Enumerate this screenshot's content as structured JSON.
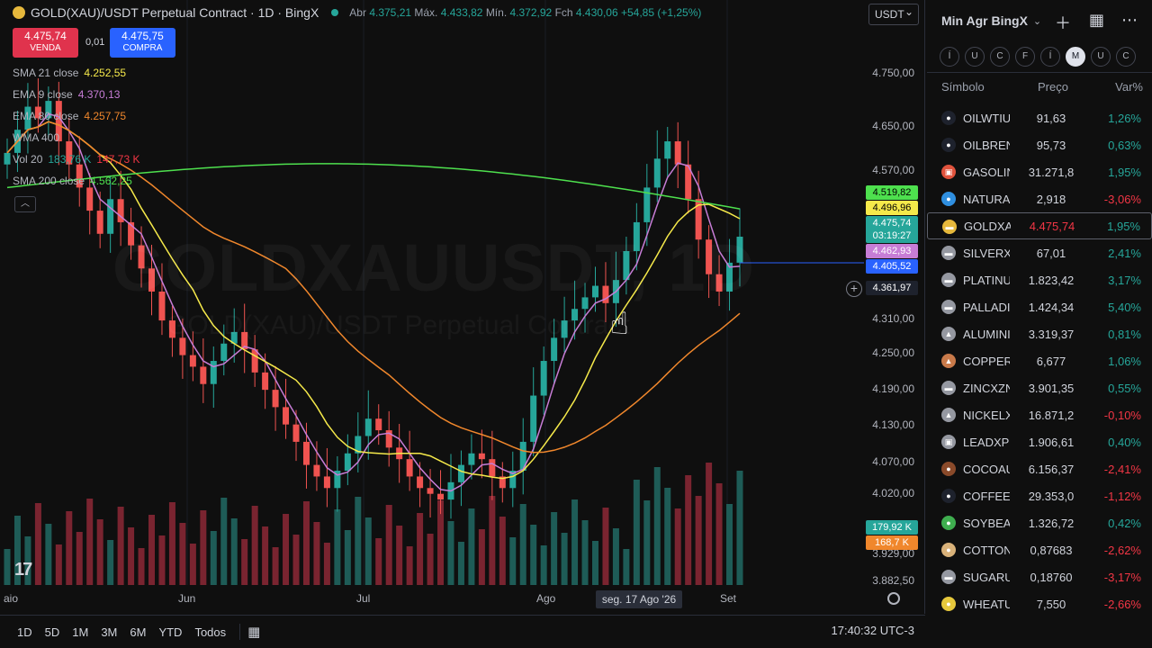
{
  "chart_header": {
    "title": "GOLD(XAU)/USDT Perpetual Contract · 1D · BingX",
    "open_label": "Abr",
    "open": "4.375,21",
    "high_label": "Máx.",
    "high": "4.433,82",
    "low_label": "Mín.",
    "low": "4.372,92",
    "close_label": "Fch",
    "close": "4.430,06",
    "change": "+54,85 (+1,25%)"
  },
  "trade": {
    "sell_price": "4.475,74",
    "sell_label": "VENDA",
    "spread": "0,01",
    "buy_price": "4.475,75",
    "buy_label": "COMPRA"
  },
  "indicators": [
    {
      "name": "SMA 21 close",
      "value": "4.252,55",
      "color": "#f5e94a"
    },
    {
      "name": "EMA 9 close",
      "value": "4.370,13",
      "color": "#c77dd6"
    },
    {
      "name": "EMA 80 close",
      "value": "4.257,75",
      "color": "#f0872c"
    },
    {
      "name": "WMA 400",
      "value": "",
      "color": "#787b86"
    },
    {
      "name": "Vol 20",
      "value": "183,76 K",
      "value2": "147,73 K",
      "color": "#26a69a"
    },
    {
      "name": "SMA 200 close",
      "value": "4.562,25",
      "color": "#4ee04e"
    }
  ],
  "watermark": {
    "line1": "GOLDXAUUSDT, 1D",
    "line2": "GOLD(XAU)/USDT Perpetual Contract"
  },
  "quote_currency": "USDT",
  "price_axis": [
    "4.750,00",
    "4.650,00",
    "4.570,00",
    "4.310,00",
    "4.250,00",
    "4.190,00",
    "4.130,00",
    "4.070,00",
    "4.020,00",
    "3.929,00",
    "3.882,50"
  ],
  "price_tags": [
    {
      "value": "4.519,82",
      "color": "#4ee04e"
    },
    {
      "value": "4.496,96",
      "color": "#f5e94a"
    },
    {
      "value": "4.475,74",
      "sub": "03:19:27",
      "color": "#26a69a"
    },
    {
      "value": "4.462,93",
      "color": "#c77dd6"
    },
    {
      "value": "4.405,52",
      "color": "#2962ff"
    },
    {
      "value": "4.361,97",
      "color": "#1e222d"
    },
    {
      "value": "179,92 K",
      "color": "#26a69a"
    },
    {
      "value": "168,7 K",
      "color": "#f0872c"
    }
  ],
  "time_axis": [
    "aio",
    "Jun",
    "Jul",
    "Ago",
    "Set"
  ],
  "crosshair_date": "seg. 17 Ago '26",
  "ranges": [
    "1D",
    "5D",
    "1M",
    "3M",
    "6M",
    "YTD",
    "Todos"
  ],
  "clock": "17:40:32 UTC-3",
  "watchlist": {
    "title": "Min Agr BingX",
    "filters": [
      "Í",
      "U",
      "C",
      "F",
      "Í",
      "M",
      "U",
      "C"
    ],
    "active_filter_index": 5,
    "col_symbol": "Símbolo",
    "col_price": "Preço",
    "col_change": "Var%",
    "rows": [
      {
        "sym": "OILWTIU",
        "price": "91,63",
        "chg": "1,26%",
        "dir": "up",
        "icon_color": "#1e222d",
        "icon": "●"
      },
      {
        "sym": "OILBREN",
        "price": "95,73",
        "chg": "0,63%",
        "dir": "up",
        "icon_color": "#1e222d",
        "icon": "●"
      },
      {
        "sym": "GASOLIN",
        "price": "31.271,8",
        "chg": "1,95%",
        "dir": "up",
        "icon_color": "#e0533d",
        "icon": "▣"
      },
      {
        "sym": "NATURA",
        "price": "2,918",
        "chg": "-3,06%",
        "dir": "down",
        "icon_color": "#2f8fe0",
        "icon": "●"
      },
      {
        "sym": "GOLDXA",
        "price": "4.475,74",
        "chg": "1,95%",
        "dir": "up",
        "icon_color": "#e6b83c",
        "icon": "▬",
        "selected": true
      },
      {
        "sym": "SILVERX",
        "price": "67,01",
        "chg": "2,41%",
        "dir": "up",
        "icon_color": "#9598a1",
        "icon": "▬"
      },
      {
        "sym": "PLATINU",
        "price": "1.823,42",
        "chg": "3,17%",
        "dir": "up",
        "icon_color": "#9598a1",
        "icon": "▬"
      },
      {
        "sym": "PALLADI",
        "price": "1.424,34",
        "chg": "5,40%",
        "dir": "up",
        "icon_color": "#9598a1",
        "icon": "▬"
      },
      {
        "sym": "ALUMINI",
        "price": "3.319,37",
        "chg": "0,81%",
        "dir": "up",
        "icon_color": "#9598a1",
        "icon": "▲"
      },
      {
        "sym": "COPPER",
        "price": "6,677",
        "chg": "1,06%",
        "dir": "up",
        "icon_color": "#c97a4a",
        "icon": "▲"
      },
      {
        "sym": "ZINCXZN",
        "price": "3.901,35",
        "chg": "0,55%",
        "dir": "up",
        "icon_color": "#9598a1",
        "icon": "▬"
      },
      {
        "sym": "NICKELX",
        "price": "16.871,2",
        "chg": "-0,10%",
        "dir": "down",
        "icon_color": "#9598a1",
        "icon": "▲"
      },
      {
        "sym": "LEADXPI",
        "price": "1.906,61",
        "chg": "0,40%",
        "dir": "up",
        "icon_color": "#9598a1",
        "icon": "▣"
      },
      {
        "sym": "COCOAU",
        "price": "6.156,37",
        "chg": "-2,41%",
        "dir": "down",
        "icon_color": "#8a4a2a",
        "icon": "●"
      },
      {
        "sym": "COFFEEU",
        "price": "29.353,0",
        "chg": "-1,12%",
        "dir": "down",
        "icon_color": "#1e222d",
        "icon": "●"
      },
      {
        "sym": "SOYBEAI",
        "price": "1.326,72",
        "chg": "0,42%",
        "dir": "up",
        "icon_color": "#3fae4f",
        "icon": "●"
      },
      {
        "sym": "COTTON",
        "price": "0,87683",
        "chg": "-2,62%",
        "dir": "down",
        "icon_color": "#d9b27a",
        "icon": "●"
      },
      {
        "sym": "SUGARU",
        "price": "0,18760",
        "chg": "-3,17%",
        "dir": "down",
        "icon_color": "#9598a1",
        "icon": "▬"
      },
      {
        "sym": "WHEATU",
        "price": "7,550",
        "chg": "-2,66%",
        "dir": "down",
        "icon_color": "#e6c83c",
        "icon": "●"
      }
    ]
  },
  "chart_data": {
    "type": "candlestick",
    "series_closes": [
      4620,
      4660,
      4700,
      4680,
      4710,
      4640,
      4600,
      4560,
      4520,
      4480,
      4540,
      4500,
      4460,
      4420,
      4380,
      4330,
      4300,
      4270,
      4250,
      4220,
      4260,
      4290,
      4310,
      4280,
      4240,
      4210,
      4180,
      4150,
      4120,
      4080,
      4060,
      4040,
      4070,
      4100,
      4130,
      4160,
      4140,
      4110,
      4090,
      4060,
      4040,
      4030,
      4020,
      4050,
      4080,
      4100,
      4090,
      4060,
      4040,
      4070,
      4120,
      4200,
      4260,
      4300,
      4330,
      4350,
      4370,
      4390,
      4360,
      4400,
      4450,
      4500,
      4560,
      4610,
      4640,
      4600,
      4540,
      4470,
      4410,
      4380,
      4430,
      4475
    ]
  }
}
